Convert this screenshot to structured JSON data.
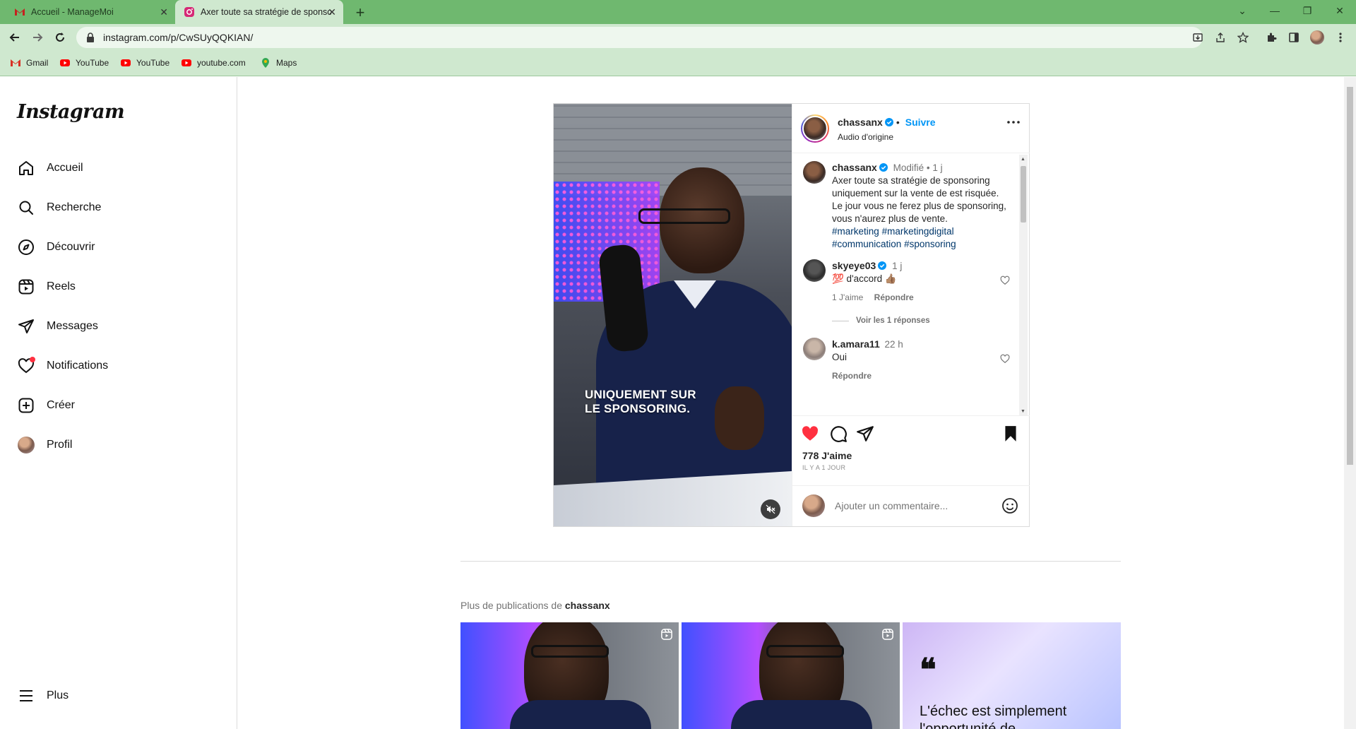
{
  "browser": {
    "tabs": [
      {
        "title": "Accueil - ManageMoi",
        "active": false
      },
      {
        "title": "Axer toute sa stratégie de sponsoring",
        "active": true
      }
    ],
    "url": "instagram.com/p/CwSUyQQKIAN/",
    "bookmarks": [
      "Gmail",
      "YouTube",
      "YouTube",
      "youtube.com",
      "Maps"
    ],
    "colors": {
      "tabbar": "#6fb86f",
      "toolbar": "#cfe8cf"
    }
  },
  "sidebar": {
    "logo": "Instagram",
    "items": [
      {
        "label": "Accueil",
        "icon": "home-icon"
      },
      {
        "label": "Recherche",
        "icon": "search-icon"
      },
      {
        "label": "Découvrir",
        "icon": "compass-icon"
      },
      {
        "label": "Reels",
        "icon": "reels-icon"
      },
      {
        "label": "Messages",
        "icon": "send-icon"
      },
      {
        "label": "Notifications",
        "icon": "heart-icon"
      },
      {
        "label": "Créer",
        "icon": "plus-square-icon"
      },
      {
        "label": "Profil",
        "icon": "avatar"
      }
    ],
    "more_label": "Plus"
  },
  "post": {
    "video_caption": [
      "UNIQUEMENT SUR",
      "LE SPONSORING."
    ],
    "author": "chassanx",
    "follow_label": "Suivre",
    "separator": "•",
    "audio": "Audio d'origine",
    "caption": {
      "username": "chassanx",
      "edited": "Modifié",
      "time": "1 j",
      "text": "Axer toute sa stratégie de sponsoring uniquement sur la vente de est risquée. Le jour vous ne ferez plus de sponsoring, vous n'aurez plus de vente.",
      "hashtags": [
        "#marketing",
        "#marketingdigital",
        "#communication",
        "#sponsoring"
      ]
    },
    "comments": [
      {
        "username": "skyeye03",
        "verified": true,
        "time": "1 j",
        "text": "💯 d'accord 👍🏽",
        "likes": "1 J'aime",
        "reply": "Répondre",
        "replies_label": "Voir les 1 réponses"
      },
      {
        "username": "k.amara11",
        "verified": false,
        "time": "22 h",
        "text": "Oui",
        "reply": "Répondre"
      }
    ],
    "likes": "778 J'aime",
    "ago": "IL Y A 1 JOUR",
    "comment_placeholder": "Ajouter un commentaire...",
    "colors": {
      "like": "#ff3040",
      "link": "#0095f6",
      "hashtag": "#00376b"
    }
  },
  "more_posts": {
    "prefix": "Plus de publications de ",
    "username": "chassanx",
    "quote_mark": "❝",
    "quote_text": "L'échec est simplement l'opportunité de"
  }
}
